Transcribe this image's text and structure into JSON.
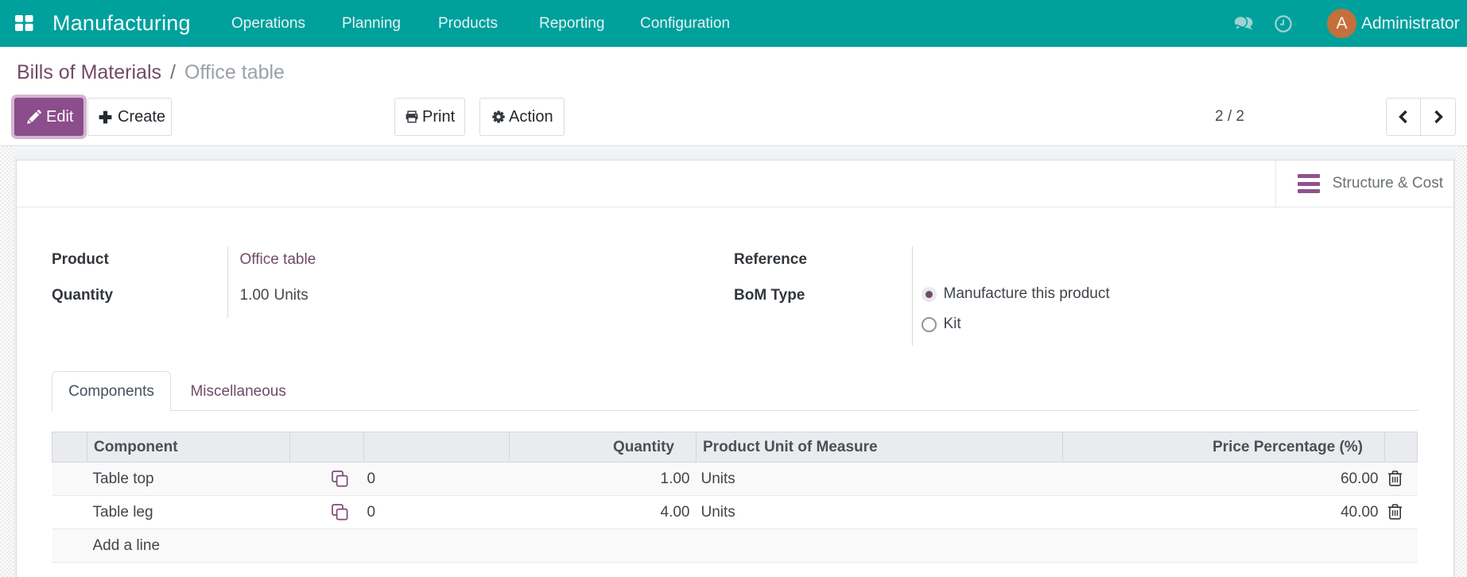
{
  "navbar": {
    "brand": "Manufacturing",
    "menu": {
      "operations": "Operations",
      "planning": "Planning",
      "products": "Products",
      "reporting": "Reporting",
      "configuration": "Configuration"
    },
    "user": "Administrator",
    "avatar_letter": "A",
    "color": "#00A09D"
  },
  "breadcrumb": {
    "parent": "Bills of Materials",
    "separator": "/",
    "current": "Office table"
  },
  "actions": {
    "edit": "Edit",
    "create": "Create",
    "print": "Print",
    "action": "Action"
  },
  "pager": {
    "text": "2 / 2"
  },
  "sheet": {
    "button_box": {
      "structure_cost": "Structure & Cost"
    },
    "fields": {
      "product": {
        "label": "Product",
        "value": "Office table"
      },
      "quantity": {
        "label": "Quantity",
        "value": "1.00",
        "unit": "Units"
      },
      "reference": {
        "label": "Reference",
        "value": ""
      },
      "bom_type": {
        "label": "BoM Type",
        "options": [
          {
            "label": "Manufacture this product",
            "selected": true
          },
          {
            "label": "Kit",
            "selected": false
          }
        ]
      }
    },
    "tabs": [
      {
        "label": "Components",
        "active": true
      },
      {
        "label": "Miscellaneous",
        "active": false
      }
    ],
    "components_table": {
      "headers": {
        "component": "Component",
        "quantity": "Quantity",
        "uom": "Product Unit of Measure",
        "price_pct": "Price Percentage (%)"
      },
      "rows": [
        {
          "component": "Table top",
          "variant_count": "0",
          "quantity": "1.00",
          "uom": "Units",
          "price_pct": "60.00"
        },
        {
          "component": "Table leg",
          "variant_count": "0",
          "quantity": "4.00",
          "uom": "Units",
          "price_pct": "40.00"
        }
      ],
      "add_line": "Add a line"
    }
  },
  "theme": {
    "primary": "#714B67",
    "navbar": "#00A09D",
    "edit_button": "#8B4D8B"
  }
}
